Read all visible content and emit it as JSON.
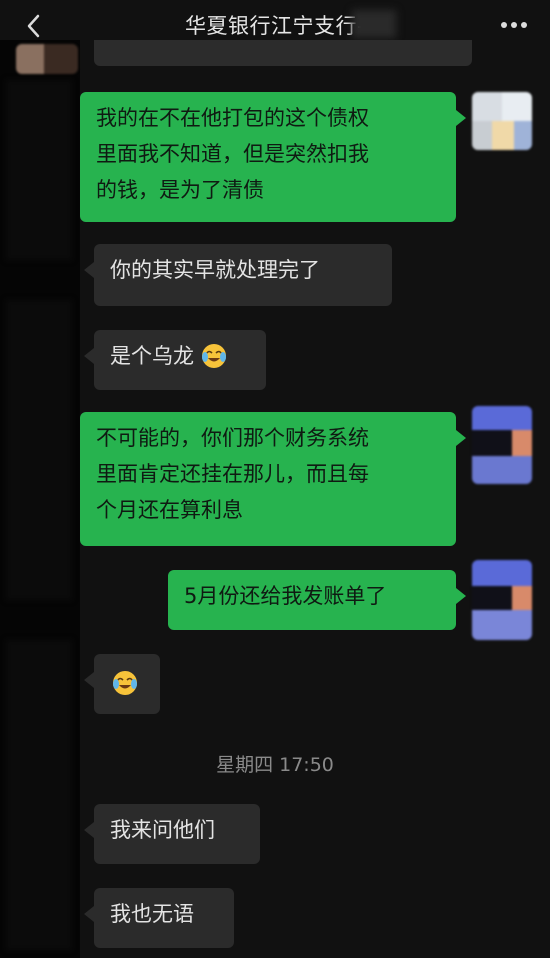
{
  "header": {
    "title": "华夏银行江宁支行-",
    "back_icon": "chevron-left-icon",
    "more_icon": "more-dots-icon"
  },
  "messages": [
    {
      "direction": "out",
      "text": "我的在不在他打包的这个债权里面我不知道，但是突然扣我的钱，是为了清债",
      "lines": [
        "我的在不在他打包的这个债权",
        "里面我不知道，但是突然扣我",
        "的钱，是为了清债"
      ]
    },
    {
      "direction": "in",
      "text": "你的其实早就处理完了"
    },
    {
      "direction": "in",
      "text": "是个乌龙",
      "emoji": "crying-laughing-face"
    },
    {
      "direction": "out",
      "text": "不可能的，你们那个财务系统里面肯定还挂在那儿，而且每个月还在算利息",
      "lines": [
        "不可能的，你们那个财务系统",
        "里面肯定还挂在那儿，而且每",
        "个月还在算利息"
      ]
    },
    {
      "direction": "out",
      "text": "5月份还给我发账单了"
    },
    {
      "direction": "in",
      "text": "",
      "emoji": "crying-laughing-face"
    },
    {
      "direction": "in",
      "text": "我来问他们"
    },
    {
      "direction": "in",
      "text": "我也无语"
    }
  ],
  "timestamp": "星期四 17:50",
  "colors": {
    "background": "#111111",
    "outgoing_bubble": "#27b34f",
    "incoming_bubble": "#2b2b2b",
    "timestamp_text": "#8a8a8a"
  }
}
